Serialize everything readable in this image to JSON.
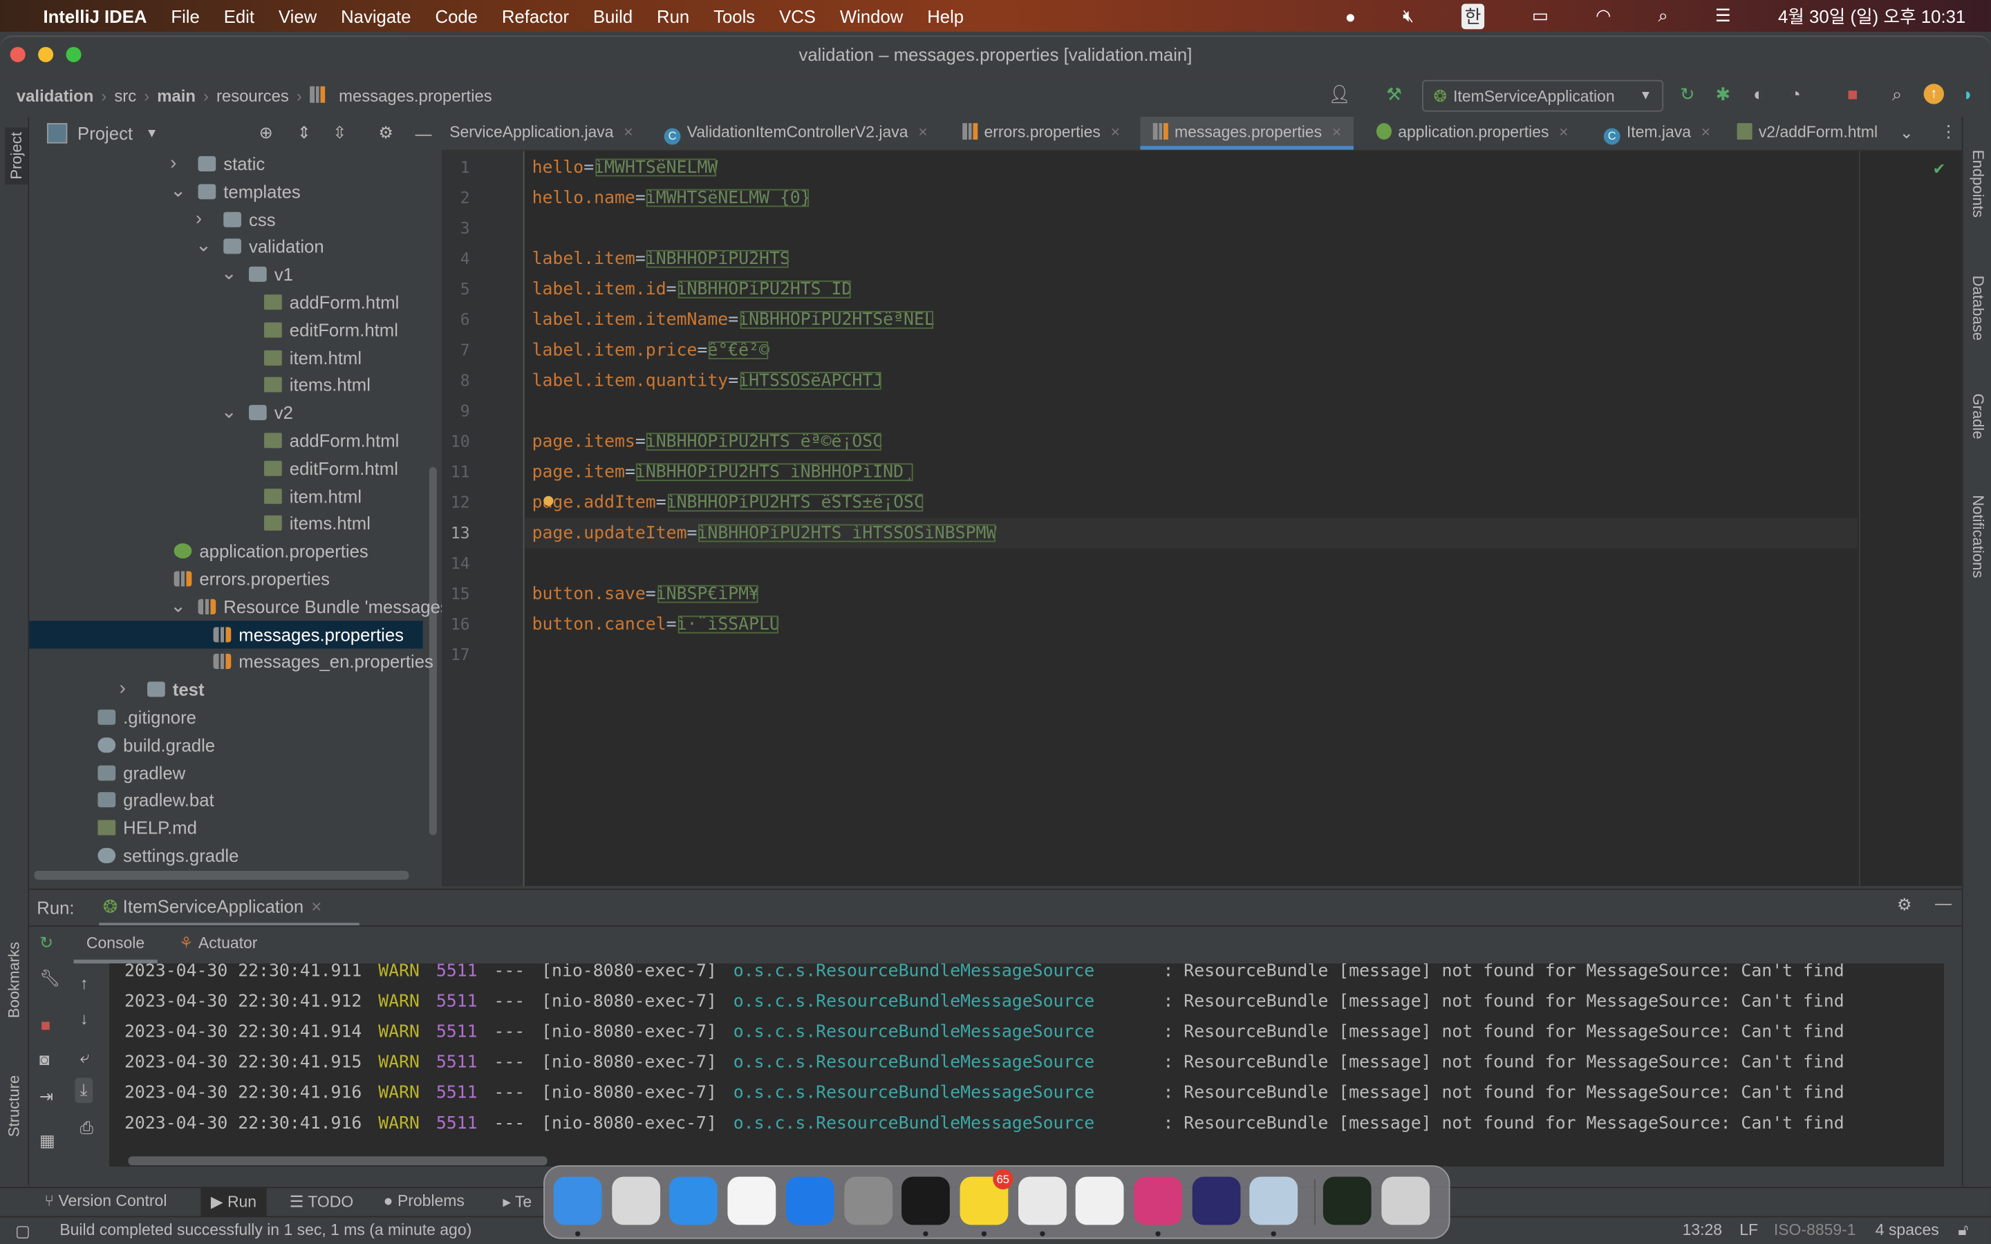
{
  "menubar": {
    "app": "IntelliJ IDEA",
    "items": [
      "File",
      "Edit",
      "View",
      "Navigate",
      "Code",
      "Refactor",
      "Build",
      "Run",
      "Tools",
      "VCS",
      "Window",
      "Help"
    ],
    "ime": "한",
    "clock": "4월 30일 (일) 오후 10:31"
  },
  "window": {
    "title": "validation – messages.properties [validation.main]"
  },
  "breadcrumb": [
    "validation",
    "src",
    "main",
    "resources",
    "messages.properties"
  ],
  "toolbar": {
    "run_config": "ItemServiceApplication"
  },
  "project": {
    "title": "Project",
    "tree": [
      {
        "label": "static",
        "level": 3,
        "type": "folder",
        "expanded": false
      },
      {
        "label": "templates",
        "level": 3,
        "type": "folder",
        "expanded": true
      },
      {
        "label": "css",
        "level": 4,
        "type": "folder",
        "expanded": false
      },
      {
        "label": "validation",
        "level": 4,
        "type": "folder",
        "expanded": true
      },
      {
        "label": "v1",
        "level": 5,
        "type": "folder",
        "expanded": true
      },
      {
        "label": "addForm.html",
        "level": 6,
        "type": "html"
      },
      {
        "label": "editForm.html",
        "level": 6,
        "type": "html"
      },
      {
        "label": "item.html",
        "level": 6,
        "type": "html"
      },
      {
        "label": "items.html",
        "level": 6,
        "type": "html"
      },
      {
        "label": "v2",
        "level": 5,
        "type": "folder",
        "expanded": true
      },
      {
        "label": "addForm.html",
        "level": 6,
        "type": "html"
      },
      {
        "label": "editForm.html",
        "level": 6,
        "type": "html"
      },
      {
        "label": "item.html",
        "level": 6,
        "type": "html"
      },
      {
        "label": "items.html",
        "level": 6,
        "type": "html"
      },
      {
        "label": "application.properties",
        "level": 3,
        "type": "spring"
      },
      {
        "label": "errors.properties",
        "level": 3,
        "type": "props"
      },
      {
        "label": "Resource Bundle 'messages'",
        "level": 3,
        "type": "props",
        "expanded": true
      },
      {
        "label": "messages.properties",
        "level": 4,
        "type": "props",
        "selected": true
      },
      {
        "label": "messages_en.properties",
        "level": 4,
        "type": "props"
      },
      {
        "label": "test",
        "level": 1,
        "type": "folder",
        "expanded": false
      },
      {
        "label": ".gitignore",
        "level": 0,
        "type": "file"
      },
      {
        "label": "build.gradle",
        "level": 0,
        "type": "gradle"
      },
      {
        "label": "gradlew",
        "level": 0,
        "type": "file"
      },
      {
        "label": "gradlew.bat",
        "level": 0,
        "type": "file"
      },
      {
        "label": "HELP.md",
        "level": 0,
        "type": "md"
      },
      {
        "label": "settings.gradle",
        "level": 0,
        "type": "gradle"
      }
    ]
  },
  "editor_tabs": [
    {
      "label": "ServiceApplication.java",
      "icon": "java"
    },
    {
      "label": "ValidationItemControllerV2.java",
      "icon": "class"
    },
    {
      "label": "errors.properties",
      "icon": "props"
    },
    {
      "label": "messages.properties",
      "icon": "props",
      "active": true
    },
    {
      "label": "application.properties",
      "icon": "spring"
    },
    {
      "label": "Item.java",
      "icon": "class"
    },
    {
      "label": "v2/addForm.html",
      "icon": "html"
    }
  ],
  "editor": {
    "current_line": 13,
    "lines": [
      {
        "key": "hello",
        "value": "ìMWHTSëNELMW"
      },
      {
        "key": "hello.name",
        "value": "ìMWHTSëNELMW {0}"
      },
      {
        "key": "",
        "value": ""
      },
      {
        "key": "label.item",
        "value": "ìNBHHOPíPU2HTS"
      },
      {
        "key": "label.item.id",
        "value": "ìNBHHOPíPU2HTS ID"
      },
      {
        "key": "label.item.itemName",
        "value": "ìNBHHOPíPU2HTSëªNEL"
      },
      {
        "key": "label.item.price",
        "value": "ê°€ê²©"
      },
      {
        "key": "label.item.quantity",
        "value": "ìHTSSOSëAPCHTJ"
      },
      {
        "key": "",
        "value": ""
      },
      {
        "key": "page.items",
        "value": "ìNBHHOPíPU2HTS ëª©ë¡OSC"
      },
      {
        "key": "page.item",
        "value": "ìNBHHOPíPU2HTS ìNBHHOPìIND¸"
      },
      {
        "key": "page.addItem",
        "value": "ìNBHHOPíPU2HTS ëSTS±ë¡OSC"
      },
      {
        "key": "page.updateItem",
        "value": "ìNBHHOPíPU2HTS ìHTSSOSìNBSPMW"
      },
      {
        "key": "",
        "value": ""
      },
      {
        "key": "button.save",
        "value": "ìNBSP€ìPM¥"
      },
      {
        "key": "button.cancel",
        "value": "ì·¨ìSSAPLU"
      },
      {
        "key": "",
        "value": ""
      }
    ]
  },
  "right_stripe": [
    "Endpoints",
    "Database",
    "Gradle",
    "Notifications"
  ],
  "left_stripe": [
    "Project",
    "Bookmarks",
    "Structure"
  ],
  "run": {
    "label": "Run:",
    "config": "ItemServiceApplication",
    "tabs": [
      "Console",
      "Actuator"
    ],
    "log": [
      {
        "ts": "2023-04-30 22:30:41.911",
        "level": "WARN",
        "pid": "5511",
        "sep": "---",
        "thread": "[nio-8080-exec-7]",
        "logger": "o.s.c.s.ResourceBundleMessageSource",
        "msg": ": ResourceBundle [message] not found for MessageSource: Can't find"
      },
      {
        "ts": "2023-04-30 22:30:41.912",
        "level": "WARN",
        "pid": "5511",
        "sep": "---",
        "thread": "[nio-8080-exec-7]",
        "logger": "o.s.c.s.ResourceBundleMessageSource",
        "msg": ": ResourceBundle [message] not found for MessageSource: Can't find"
      },
      {
        "ts": "2023-04-30 22:30:41.914",
        "level": "WARN",
        "pid": "5511",
        "sep": "---",
        "thread": "[nio-8080-exec-7]",
        "logger": "o.s.c.s.ResourceBundleMessageSource",
        "msg": ": ResourceBundle [message] not found for MessageSource: Can't find"
      },
      {
        "ts": "2023-04-30 22:30:41.915",
        "level": "WARN",
        "pid": "5511",
        "sep": "---",
        "thread": "[nio-8080-exec-7]",
        "logger": "o.s.c.s.ResourceBundleMessageSource",
        "msg": ": ResourceBundle [message] not found for MessageSource: Can't find"
      },
      {
        "ts": "2023-04-30 22:30:41.916",
        "level": "WARN",
        "pid": "5511",
        "sep": "---",
        "thread": "[nio-8080-exec-7]",
        "logger": "o.s.c.s.ResourceBundleMessageSource",
        "msg": ": ResourceBundle [message] not found for MessageSource: Can't find"
      },
      {
        "ts": "2023-04-30 22:30:41.916",
        "level": "WARN",
        "pid": "5511",
        "sep": "---",
        "thread": "[nio-8080-exec-7]",
        "logger": "o.s.c.s.ResourceBundleMessageSource",
        "msg": ": ResourceBundle [message] not found for MessageSource: Can't find"
      }
    ]
  },
  "bottom_tools": [
    "Version Control",
    "Run",
    "TODO",
    "Problems",
    "Te"
  ],
  "status": {
    "message": "Build completed successfully in 1 sec, 1 ms (a minute ago)",
    "position": "13:28",
    "line_sep": "LF",
    "encoding": "ISO-8859-1",
    "indent": "4 spaces"
  },
  "dock": {
    "apps": [
      {
        "name": "Finder",
        "color": "#3a8ee6",
        "running": true
      },
      {
        "name": "Launchpad",
        "color": "#d8d8d8"
      },
      {
        "name": "Safari",
        "color": "#2f8ee8"
      },
      {
        "name": "Photos",
        "color": "#f4f4f4"
      },
      {
        "name": "App Store",
        "color": "#1f7ae8"
      },
      {
        "name": "System Preferences",
        "color": "#8a8a8a"
      },
      {
        "name": "Terminal",
        "color": "#1a1a1a",
        "running": true
      },
      {
        "name": "KakaoTalk",
        "color": "#f8d630",
        "running": true,
        "badge": "65"
      },
      {
        "name": "Chrome",
        "color": "#e8e8e8",
        "running": true
      },
      {
        "name": "VS Code",
        "color": "#f0f0f0"
      },
      {
        "name": "IntelliJ IDEA",
        "color": "#d23a7a",
        "running": true
      },
      {
        "name": "Eclipse",
        "color": "#2c2a6a"
      },
      {
        "name": "Preview",
        "color": "#b8cce0",
        "running": true
      },
      {
        "name": "Screenshot",
        "color": "#1e2a1e"
      },
      {
        "name": "Trash",
        "color": "#d0d0d0"
      }
    ]
  },
  "colors": {
    "key": "#cc7832",
    "value": "#6a8759",
    "selection": "#0d293e",
    "accent": "#4a88c7",
    "warn": "#bbb529",
    "pid": "#b070d0",
    "logger": "#3ca8a8"
  }
}
